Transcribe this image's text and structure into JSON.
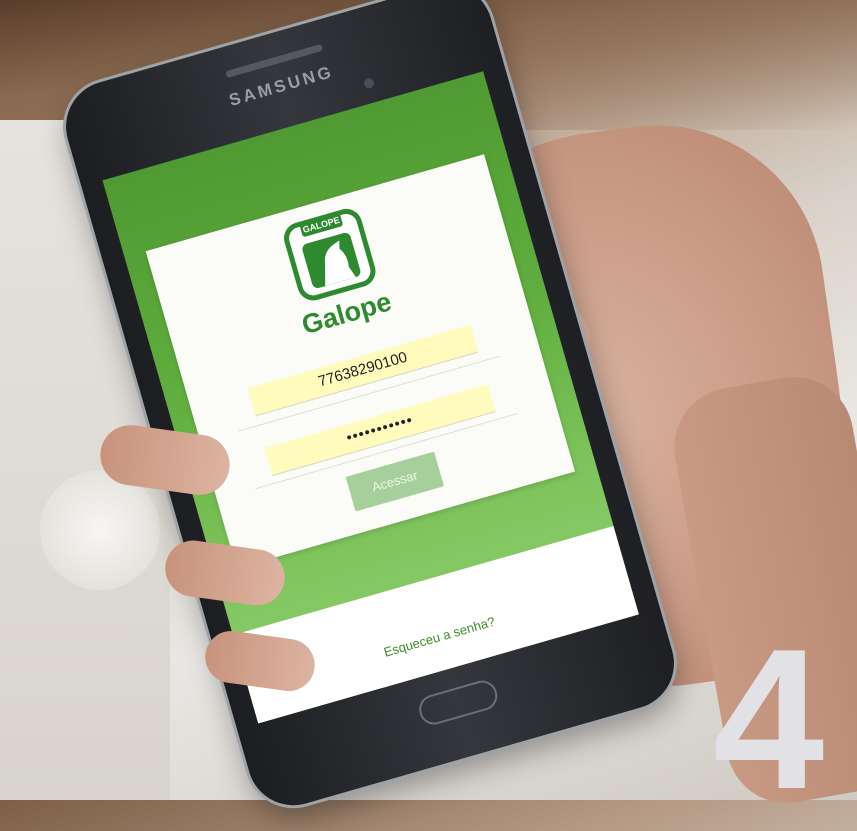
{
  "phone": {
    "brand": "SAMSUNG"
  },
  "app": {
    "logo_tab": "GALOPE",
    "name": "Galope",
    "username_value": "77638290100",
    "password_value": "•••••••••••",
    "login_button": "Acessar",
    "forgot_link": "Esqueceu a senha?"
  },
  "overlay": {
    "step_number": "4"
  },
  "colors": {
    "brand_green": "#2d8a2e",
    "screen_green": "#5fae3e",
    "field_yellow": "#fffbbd",
    "button_disabled": "#a7cf9b"
  },
  "icons": {
    "logo": "horse-head-icon"
  }
}
